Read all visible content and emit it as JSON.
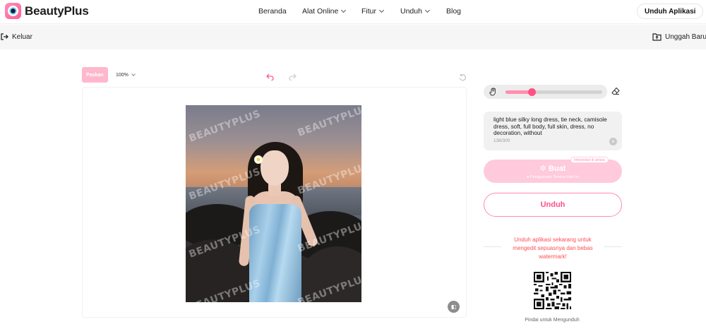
{
  "app": {
    "name": "BeautyPlus",
    "brand_color": "#ff4f86"
  },
  "nav": {
    "items": [
      {
        "label": "Beranda",
        "has_dropdown": false
      },
      {
        "label": "Alat Online",
        "has_dropdown": true
      },
      {
        "label": "Fitur",
        "has_dropdown": true
      },
      {
        "label": "Unduh",
        "has_dropdown": true
      },
      {
        "label": "Blog",
        "has_dropdown": false
      }
    ],
    "download_app_label": "Unduh Aplikasi"
  },
  "subbar": {
    "exit_label": "Keluar",
    "upload_label": "Unggah Baru"
  },
  "editor": {
    "fit_label": "Paskan",
    "zoom_value": "100%",
    "watermark_text": "BEAUTYPLUS"
  },
  "panel": {
    "brush_slider": {
      "value": 0.27
    },
    "prompt": {
      "text": "light blue silky long dress, tie neck, camisole dress, soft, full body, full skin, dress, no decoration, without",
      "count": "136/300"
    },
    "generate": {
      "label": "Buat",
      "badge": "Interpolasi di antara",
      "sub_label": "Penggunaan Tersisa Hari Ini"
    },
    "download_label": "Unduh",
    "promo_text": "Unduh aplikasi sekarang untuk mengedit sepuasnya dan bebas watermark!",
    "qr_caption": "Pindai untuk Mengunduh"
  }
}
